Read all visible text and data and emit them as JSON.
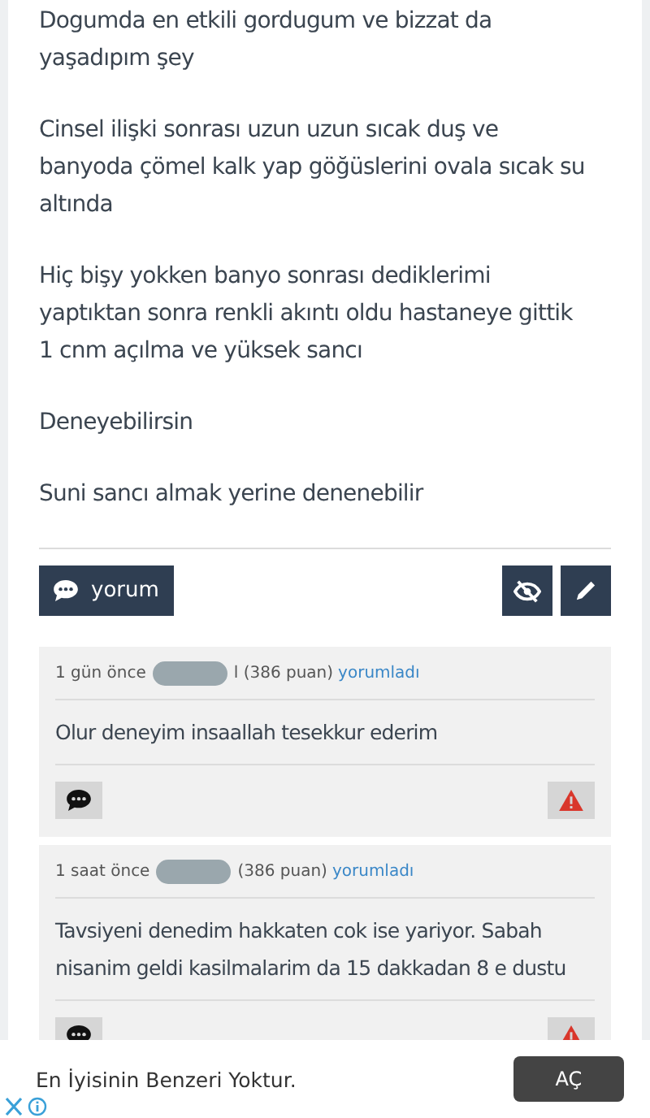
{
  "post": {
    "paragraphs": [
      [
        "Dogumda en etkili gordugum ve bizzat da",
        "yaşadıpım şey"
      ],
      [
        "Cinsel ilişki sonrası uzun uzun sıcak duş ve",
        "banyoda çömel kalk yap göğüslerini ovala sıcak su",
        "altında"
      ],
      [
        "Hiç bişy yokken banyo sonrası dediklerimi",
        "yaptıktan sonra renkli  akıntı oldu hastaneye gittik",
        "1 cnm açılma ve yüksek sancı"
      ],
      [
        "Deneyebilirsin"
      ],
      [
        "Suni sancı almak yerine denenebilir"
      ]
    ],
    "comment_button": "yorum"
  },
  "comments": [
    {
      "time": "1 gün önce",
      "author_fragment": "l (386 puan)",
      "action": "yorumladı",
      "text": [
        "Olur deneyim insaallah tesekkur ederim"
      ]
    },
    {
      "time": "1 saat önce",
      "author_fragment": "(386 puan)",
      "action": "yorumladı",
      "text": [
        "Tavsiyeni denedim hakkaten cok ise yariyor. Sabah",
        "nisanim geldi kasilmalarim da 15 dakkadan 8 e dustu"
      ]
    }
  ],
  "ad": {
    "text": "En İyisinin Benzeri Yoktur.",
    "button": "AÇ"
  }
}
